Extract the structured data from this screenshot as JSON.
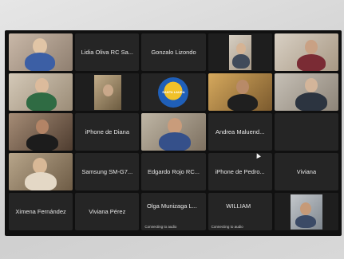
{
  "tiles": [
    {
      "type": "video",
      "name": ""
    },
    {
      "type": "name",
      "name": "Lidia Oliva RC Sa..."
    },
    {
      "type": "name",
      "name": "Gonzalo Lizondo"
    },
    {
      "type": "video",
      "name": ""
    },
    {
      "type": "video",
      "name": ""
    },
    {
      "type": "video",
      "name": ""
    },
    {
      "type": "video",
      "name": ""
    },
    {
      "type": "logo",
      "name": "SANTA LAURA"
    },
    {
      "type": "video",
      "name": ""
    },
    {
      "type": "video",
      "name": ""
    },
    {
      "type": "video",
      "name": ""
    },
    {
      "type": "name",
      "name": "iPhone de Diana"
    },
    {
      "type": "video",
      "name": ""
    },
    {
      "type": "name",
      "name": "Andrea Maluend..."
    },
    {
      "type": "empty",
      "name": ""
    },
    {
      "type": "video",
      "name": ""
    },
    {
      "type": "name",
      "name": "Samsung SM-G7..."
    },
    {
      "type": "name",
      "name": "Edgardo Rojo RC..."
    },
    {
      "type": "name",
      "name": "iPhone de Pedro..."
    },
    {
      "type": "name",
      "name": "Viviana"
    },
    {
      "type": "name",
      "name": "Ximena Fernández"
    },
    {
      "type": "name",
      "name": "Viviana Pérez"
    },
    {
      "type": "name",
      "name": "Olga Munizaga L...",
      "status": "Connecting to audio"
    },
    {
      "type": "name",
      "name": "WILLIAM",
      "status": "Connecting to audio"
    },
    {
      "type": "video",
      "name": ""
    }
  ]
}
